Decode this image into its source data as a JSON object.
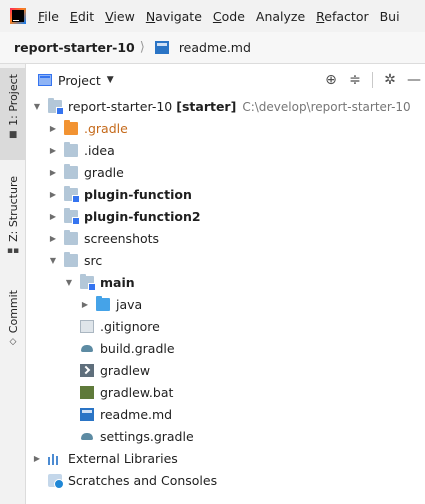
{
  "menubar": {
    "items": [
      {
        "first": "F",
        "rest": "ile"
      },
      {
        "first": "E",
        "rest": "dit"
      },
      {
        "first": "V",
        "rest": "iew"
      },
      {
        "first": "N",
        "rest": "avigate"
      },
      {
        "first": "C",
        "rest": "ode"
      },
      {
        "first": "",
        "rest": "Analyze"
      },
      {
        "first": "R",
        "rest": "efactor"
      },
      {
        "first": "",
        "rest": "Bui"
      }
    ]
  },
  "breadcrumb": {
    "project": "report-starter-10",
    "file": "readme.md"
  },
  "toolstrip": {
    "project_tab": "1: Project",
    "structure_tab": "Z: Structure",
    "commit_tab": "Commit"
  },
  "panel": {
    "title": "Project"
  },
  "tree": {
    "root_name": "report-starter-10",
    "root_module": "[starter]",
    "root_path": "C:\\develop\\report-starter-10",
    "items": [
      {
        "label": ".gradle"
      },
      {
        "label": ".idea"
      },
      {
        "label": "gradle"
      },
      {
        "label": "plugin-function"
      },
      {
        "label": "plugin-function2"
      },
      {
        "label": "screenshots"
      },
      {
        "label": "src"
      },
      {
        "label": "main"
      },
      {
        "label": "java"
      },
      {
        "label": ".gitignore"
      },
      {
        "label": "build.gradle"
      },
      {
        "label": "gradlew"
      },
      {
        "label": "gradlew.bat"
      },
      {
        "label": "readme.md"
      },
      {
        "label": "settings.gradle"
      }
    ],
    "external_libraries": "External Libraries",
    "scratches": "Scratches and Consoles"
  }
}
